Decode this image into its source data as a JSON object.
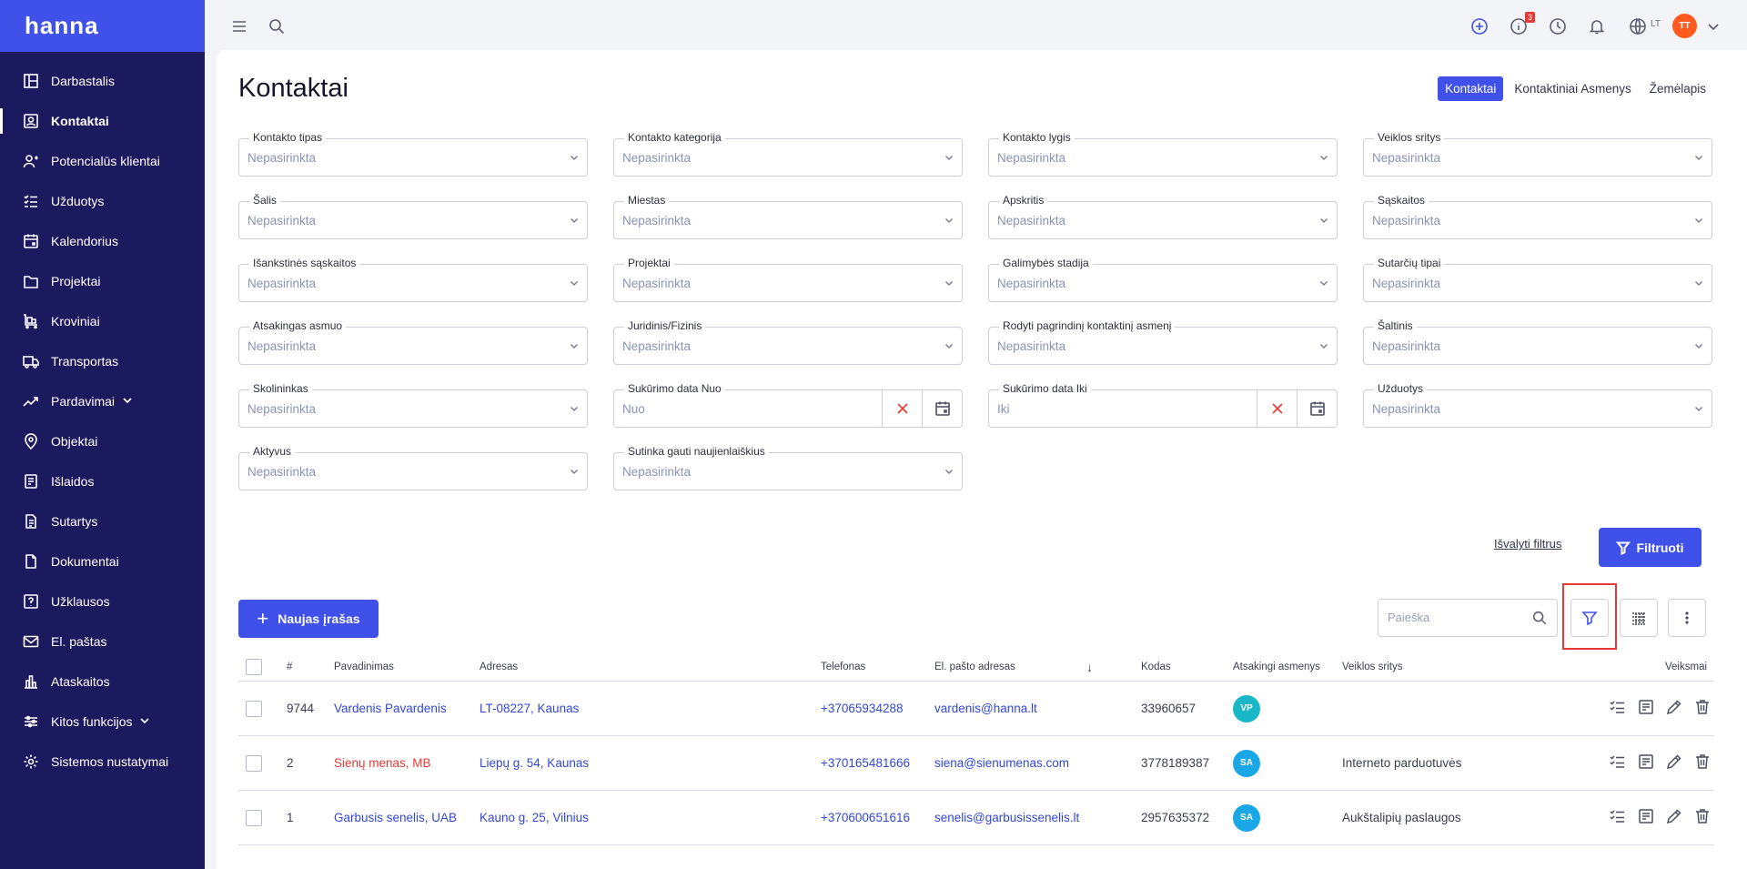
{
  "brand": "hanna",
  "sidebar": {
    "items": [
      {
        "label": "Darbastalis",
        "icon": "dashboard-icon"
      },
      {
        "label": "Kontaktai",
        "icon": "contacts-icon",
        "active": true
      },
      {
        "label": "Potencialūs klientai",
        "icon": "leads-icon"
      },
      {
        "label": "Užduotys",
        "icon": "tasks-icon"
      },
      {
        "label": "Kalendorius",
        "icon": "calendar-icon"
      },
      {
        "label": "Projektai",
        "icon": "folder-icon"
      },
      {
        "label": "Kroviniai",
        "icon": "cargo-icon"
      },
      {
        "label": "Transportas",
        "icon": "truck-icon"
      },
      {
        "label": "Pardavimai",
        "icon": "sales-icon",
        "expandable": true
      },
      {
        "label": "Objektai",
        "icon": "location-icon"
      },
      {
        "label": "Išlaidos",
        "icon": "expenses-icon"
      },
      {
        "label": "Sutartys",
        "icon": "contract-icon"
      },
      {
        "label": "Dokumentai",
        "icon": "document-icon"
      },
      {
        "label": "Užklausos",
        "icon": "question-icon"
      },
      {
        "label": "El. paštas",
        "icon": "mail-icon"
      },
      {
        "label": "Ataskaitos",
        "icon": "chart-icon"
      },
      {
        "label": "Kitos funkcijos",
        "icon": "sliders-icon",
        "expandable": true
      },
      {
        "label": "Sistemos nustatymai",
        "icon": "gear-icon"
      }
    ]
  },
  "topbar": {
    "info_badge": "3",
    "language": "LT",
    "avatar_initials": "TT"
  },
  "page": {
    "title": "Kontaktai",
    "tabs": [
      {
        "label": "Kontaktai",
        "active": true
      },
      {
        "label": "Kontaktiniai Asmenys"
      },
      {
        "label": "Žemėlapis"
      }
    ]
  },
  "filters": {
    "fields": [
      {
        "label": "Kontakto tipas",
        "value": "Nepasirinkta"
      },
      {
        "label": "Kontakto kategorija",
        "value": "Nepasirinkta"
      },
      {
        "label": "Kontakto lygis",
        "value": "Nepasirinkta"
      },
      {
        "label": "Veiklos sritys",
        "value": "Nepasirinkta"
      },
      {
        "label": "Šalis",
        "value": "Nepasirinkta"
      },
      {
        "label": "Miestas",
        "value": "Nepasirinkta"
      },
      {
        "label": "Apskritis",
        "value": "Nepasirinkta"
      },
      {
        "label": "Sąskaitos",
        "value": "Nepasirinkta"
      },
      {
        "label": "Išankstinės sąskaitos",
        "value": "Nepasirinkta"
      },
      {
        "label": "Projektai",
        "value": "Nepasirinkta"
      },
      {
        "label": "Galimybės stadija",
        "value": "Nepasirinkta"
      },
      {
        "label": "Sutarčių tipai",
        "value": "Nepasirinkta"
      },
      {
        "label": "Atsakingas asmuo",
        "value": "Nepasirinkta"
      },
      {
        "label": "Juridinis/Fizinis",
        "value": "Nepasirinkta"
      },
      {
        "label": "Rodyti pagrindinį kontaktinį asmenį",
        "value": "Nepasirinkta"
      },
      {
        "label": "Šaltinis",
        "value": "Nepasirinkta"
      },
      {
        "label": "Skolininkas",
        "value": "Nepasirinkta"
      },
      {
        "label": "Sukūrimo data Nuo",
        "value": "Nuo",
        "type": "date"
      },
      {
        "label": "Sukūrimo data Iki",
        "value": "Iki",
        "type": "date"
      },
      {
        "label": "Užduotys",
        "value": "Nepasirinkta"
      },
      {
        "label": "Aktyvus",
        "value": "Nepasirinkta"
      },
      {
        "label": "Sutinka gauti naujienlaiškius",
        "value": "Nepasirinkta"
      }
    ],
    "clear_label": "Išvalyti filtrus",
    "apply_label": "Filtruoti"
  },
  "toolbar": {
    "new_label": "Naujas įrašas",
    "search_placeholder": "Paieška"
  },
  "table": {
    "headers": {
      "num": "#",
      "name": "Pavadinimas",
      "address": "Adresas",
      "phone": "Telefonas",
      "email": "El. pašto adresas",
      "sort_arrow": "↓",
      "code": "Kodas",
      "responsible": "Atsakingi asmenys",
      "activity": "Veiklos sritys",
      "actions": "Veiksmai"
    },
    "rows": [
      {
        "num": "9744",
        "name": "Vardenis Pavardenis",
        "name_color": "blue",
        "address": "LT-08227, Kaunas",
        "phone": "+37065934288",
        "email": "vardenis@hanna.lt",
        "code": "33960657",
        "responsible": "VP",
        "avatar_color": "#1ab7c9",
        "activity": ""
      },
      {
        "num": "2",
        "name": "Sienų menas, MB",
        "name_color": "red",
        "address": "Liepų g. 54, Kaunas",
        "phone": "+370165481666",
        "email": "siena@sienumenas.com",
        "code": "3778189387",
        "responsible": "SA",
        "avatar_color": "#1aa7e8",
        "activity": "Interneto parduotuvės"
      },
      {
        "num": "1",
        "name": "Garbusis senelis, UAB",
        "name_color": "blue",
        "address": "Kauno g. 25, Vilnius",
        "phone": "+370600651616",
        "email": "senelis@garbusissenelis.lt",
        "code": "2957635372",
        "responsible": "SA",
        "avatar_color": "#1aa7e8",
        "activity": "Aukštalipių paslaugos"
      }
    ]
  }
}
